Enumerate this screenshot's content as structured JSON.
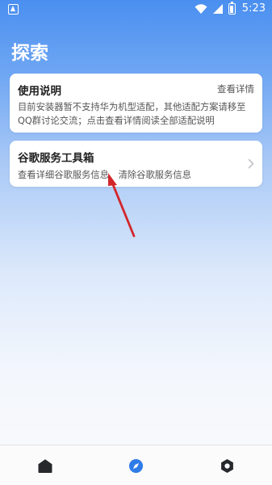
{
  "status_bar": {
    "time": "5:23",
    "icons": [
      "app-notification-icon",
      "wifi-icon",
      "signal-icon",
      "battery-icon"
    ]
  },
  "header": {
    "title": "探索"
  },
  "cards": {
    "usage": {
      "title": "使用说明",
      "link": "查看详情",
      "description": "目前安装器暂不支持华为机型适配，其他适配方案请移至QQ群讨论交流；点击查看详情阅读全部适配说明"
    },
    "google": {
      "title": "谷歌服务工具箱",
      "action_details": "查看详细谷歌服务信息",
      "action_clear": "清除谷歌服务信息"
    }
  },
  "bottom_nav": {
    "items": [
      {
        "icon": "home-icon",
        "active": false
      },
      {
        "icon": "compass-icon",
        "active": true
      },
      {
        "icon": "settings-icon",
        "active": false
      }
    ]
  },
  "colors": {
    "header_blue": "#4a8ff0",
    "active_nav": "#2f7be8",
    "annotation_red": "#d3262a"
  }
}
